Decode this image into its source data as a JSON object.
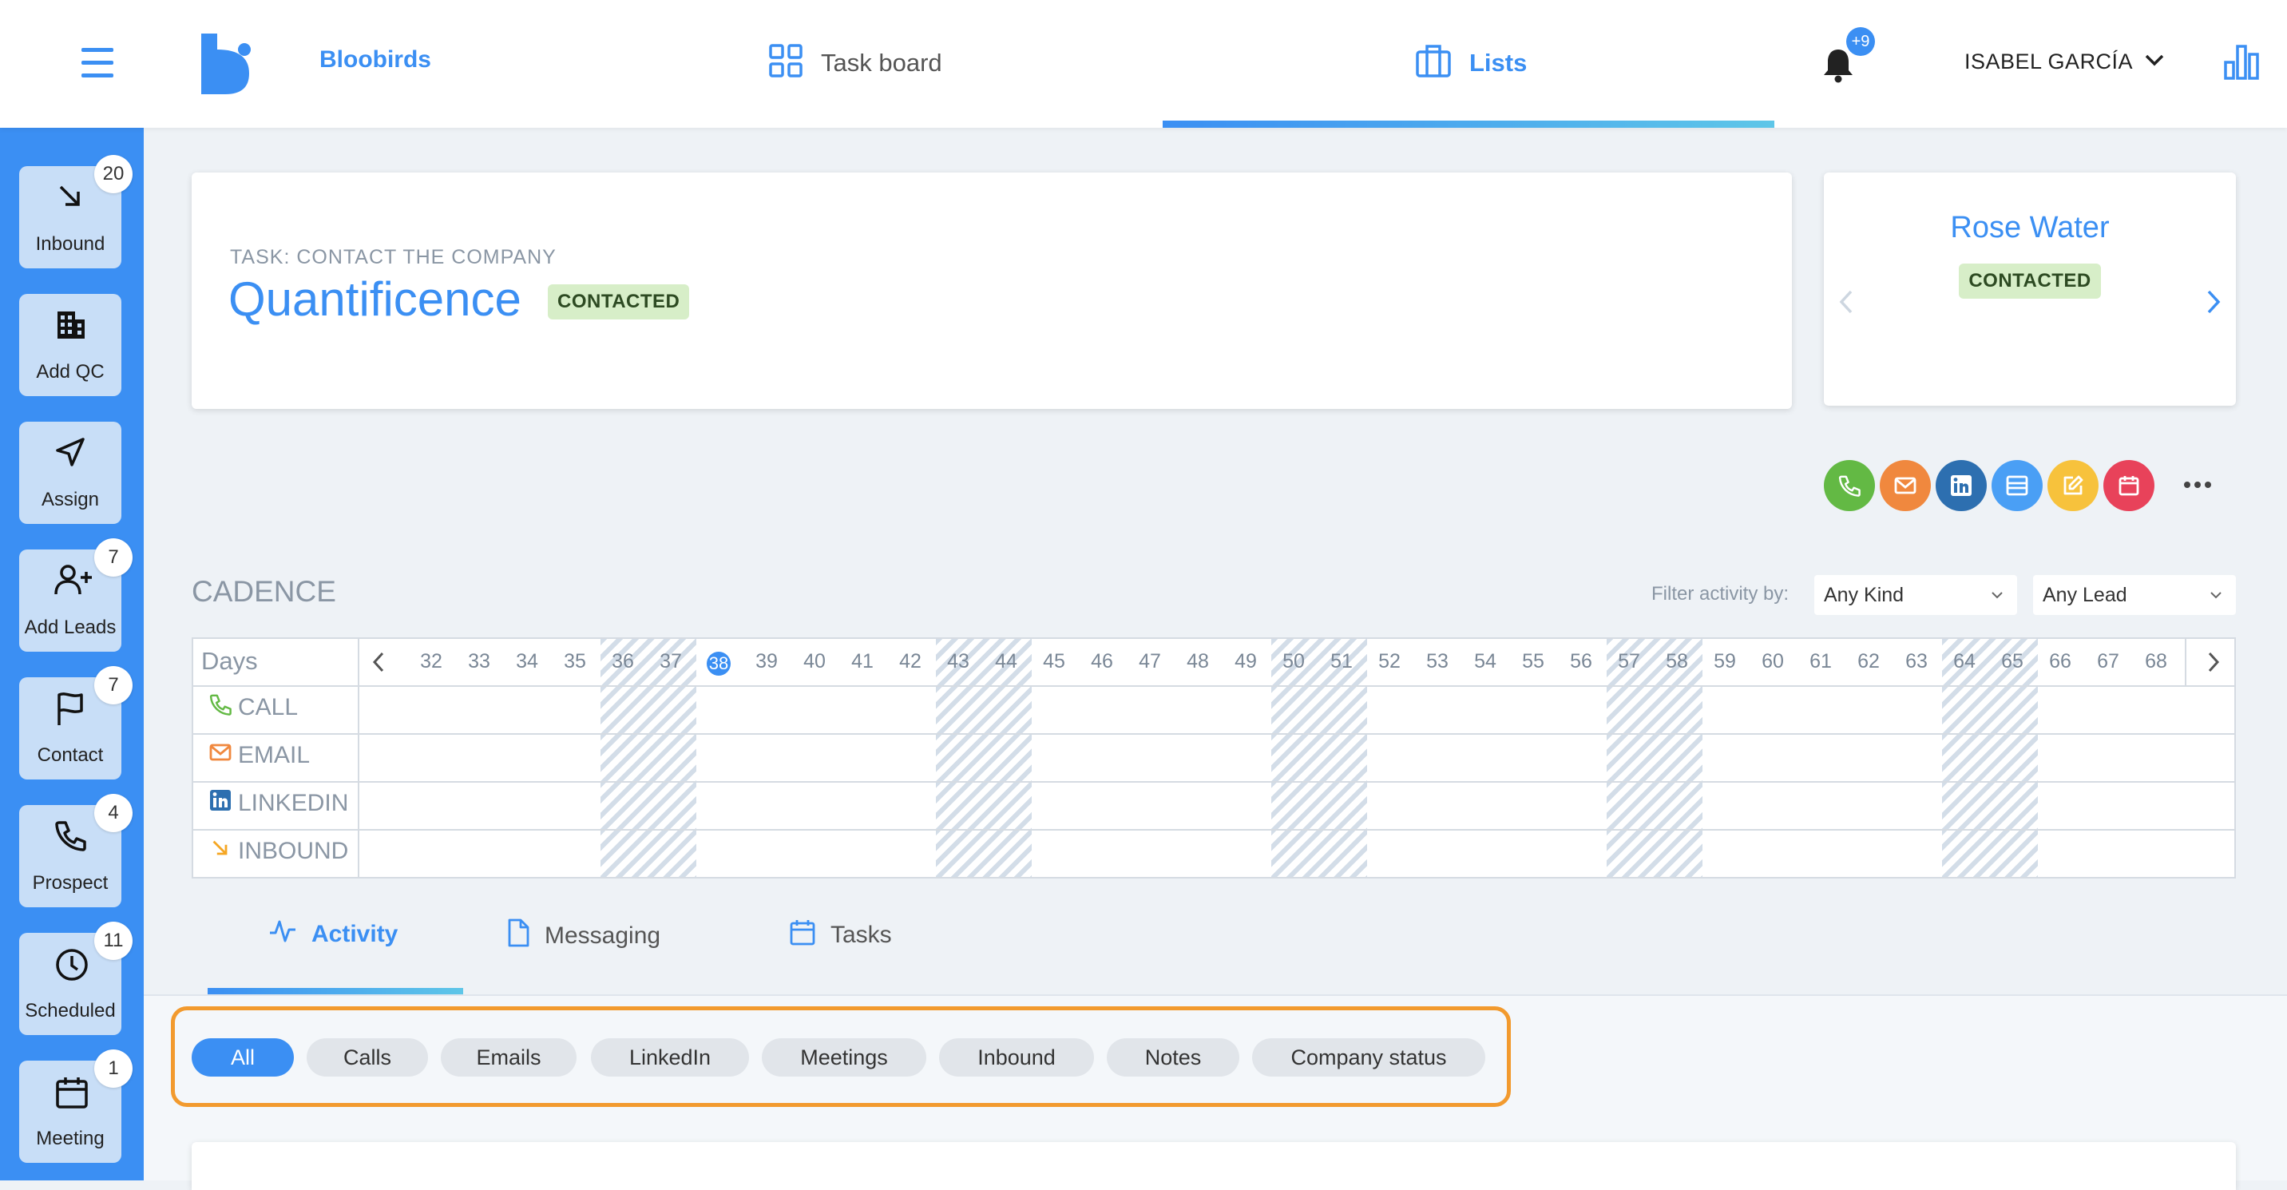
{
  "header": {
    "brand": "Bloobirds",
    "nav": [
      {
        "label": "Task board",
        "icon": "grid-icon"
      },
      {
        "label": "Lists",
        "icon": "briefcase-icon",
        "active": true
      }
    ],
    "notifications_badge": "+9",
    "user_name": "ISABEL GARCÍA"
  },
  "sidebar": {
    "items": [
      {
        "label": "Inbound",
        "badge": "20",
        "icon": "arrow-down-right-icon"
      },
      {
        "label": "Add QC",
        "badge": "",
        "icon": "building-icon"
      },
      {
        "label": "Assign",
        "badge": "",
        "icon": "send-icon"
      },
      {
        "label": "Add Leads",
        "badge": "7",
        "icon": "add-person-icon"
      },
      {
        "label": "Contact",
        "badge": "7",
        "icon": "flag-icon"
      },
      {
        "label": "Prospect",
        "badge": "4",
        "icon": "phone-icon"
      },
      {
        "label": "Scheduled",
        "badge": "11",
        "icon": "clock-icon"
      },
      {
        "label": "Meeting",
        "badge": "1",
        "icon": "calendar-icon"
      }
    ]
  },
  "company_card": {
    "task_label": "TASK: CONTACT THE COMPANY",
    "company_name": "Quantificence",
    "status": "CONTACTED"
  },
  "lead_card": {
    "name": "Rose Water",
    "status": "CONTACTED"
  },
  "actions": [
    {
      "name": "call",
      "color": "#63b944",
      "icon": "phone-icon"
    },
    {
      "name": "email",
      "color": "#f0883e",
      "icon": "mail-icon"
    },
    {
      "name": "linkedin",
      "color": "#2d6fb0",
      "icon": "linkedin-icon"
    },
    {
      "name": "meeting",
      "color": "#4a9ff5",
      "icon": "calendar-card-icon"
    },
    {
      "name": "note",
      "color": "#f7c23c",
      "icon": "edit-icon"
    },
    {
      "name": "task",
      "color": "#e8425a",
      "icon": "calendar-icon"
    }
  ],
  "cadence": {
    "title": "CADENCE",
    "filter_label": "Filter activity by:",
    "filter_kind": "Any Kind",
    "filter_lead": "Any Lead",
    "days_label": "Days",
    "days": [
      "32",
      "33",
      "34",
      "35",
      "36",
      "37",
      "38",
      "39",
      "40",
      "41",
      "42",
      "43",
      "44",
      "45",
      "46",
      "47",
      "48",
      "49",
      "50",
      "51",
      "52",
      "53",
      "54",
      "55",
      "56",
      "57",
      "58",
      "59",
      "60",
      "61",
      "62",
      "63",
      "64",
      "65",
      "66",
      "67",
      "68"
    ],
    "today": "38",
    "rows": [
      {
        "label": "CALL",
        "icon": "phone-icon",
        "color": "#63b944"
      },
      {
        "label": "EMAIL",
        "icon": "mail-icon",
        "color": "#f0883e"
      },
      {
        "label": "LINKEDIN",
        "icon": "linkedin-icon",
        "color": "#2d6fb0"
      },
      {
        "label": "INBOUND",
        "icon": "arrow-down-right-icon",
        "color": "#f5a623"
      }
    ]
  },
  "tabs": [
    {
      "label": "Activity",
      "icon": "activity-icon",
      "active": true
    },
    {
      "label": "Messaging",
      "icon": "file-icon"
    },
    {
      "label": "Tasks",
      "icon": "calendar-icon"
    }
  ],
  "filters": [
    "All",
    "Calls",
    "Emails",
    "LinkedIn",
    "Meetings",
    "Inbound",
    "Notes",
    "Company status"
  ],
  "active_filter": "All",
  "colors": {
    "accent": "#3b8ff3",
    "highlight": "#f29a2e"
  }
}
